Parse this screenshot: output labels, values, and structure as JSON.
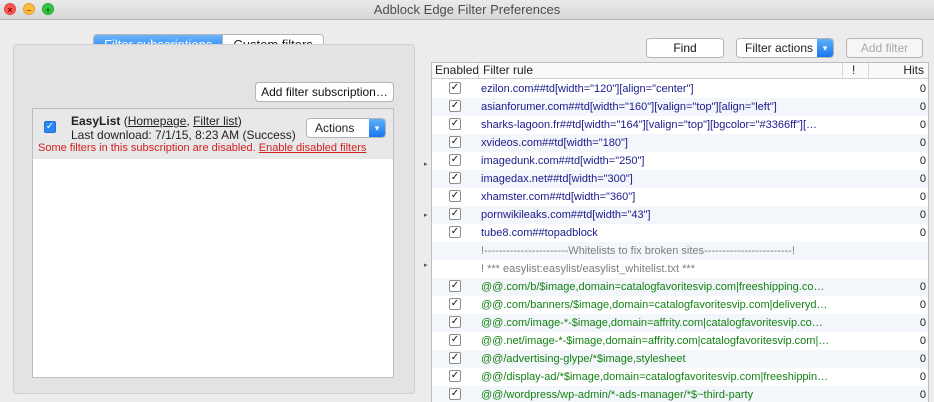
{
  "window": {
    "title": "Adblock Edge Filter Preferences"
  },
  "tabs": [
    {
      "label": "Filter subscriptions",
      "active": true
    },
    {
      "label": "Custom filters",
      "active": false
    }
  ],
  "left": {
    "add_subscription_label": "Add filter subscription…",
    "subscription": {
      "name": "EasyList",
      "homepage_label": "Homepage",
      "filterlist_label": "Filter list",
      "last_download": "Last download:  7/1/15, 8:23 AM (Success)",
      "warning": "Some filters in this subscription are disabled.",
      "enable_link": "Enable disabled filters",
      "actions_label": "Actions",
      "enabled": true
    }
  },
  "toolbar": {
    "find_label": "Find",
    "filter_actions_label": "Filter actions",
    "add_filter_label": "Add filter"
  },
  "table": {
    "headers": {
      "enabled": "Enabled",
      "rule": "Filter rule",
      "flag": "!",
      "hits": "Hits"
    },
    "rows": [
      {
        "enabled": true,
        "rule": "ezilon.com##td[width=\"120\"][align=\"center\"]",
        "hits": "0",
        "kind": "rule"
      },
      {
        "enabled": true,
        "rule": "asianforumer.com##td[width=\"160\"][valign=\"top\"][align=\"left\"]",
        "hits": "0",
        "kind": "rule"
      },
      {
        "enabled": true,
        "rule": "sharks-lagoon.fr##td[width=\"164\"][valign=\"top\"][bgcolor=\"#3366ff\"][…",
        "hits": "0",
        "kind": "rule"
      },
      {
        "enabled": true,
        "rule": "xvideos.com##td[width=\"180\"]",
        "hits": "0",
        "kind": "rule"
      },
      {
        "enabled": true,
        "rule": "imagedunk.com##td[width=\"250\"]",
        "hits": "0",
        "kind": "rule"
      },
      {
        "enabled": true,
        "rule": "imagedax.net##td[width=\"300\"]",
        "hits": "0",
        "kind": "rule"
      },
      {
        "enabled": true,
        "rule": "xhamster.com##td[width=\"360\"]",
        "hits": "0",
        "kind": "rule"
      },
      {
        "enabled": true,
        "rule": "pornwikileaks.com##td[width=\"43\"]",
        "hits": "0",
        "kind": "rule"
      },
      {
        "enabled": true,
        "rule": "tube8.com##topadblock",
        "hits": "0",
        "kind": "rule"
      },
      {
        "enabled": null,
        "rule": "!-----------------------Whitelists to fix broken sites------------------------!",
        "hits": "",
        "kind": "comment"
      },
      {
        "enabled": null,
        "rule": "! *** easylist:easylist/easylist_whitelist.txt ***",
        "hits": "",
        "kind": "comment"
      },
      {
        "enabled": true,
        "rule": "@@.com/b/$image,domain=catalogfavoritesvip.com|freeshipping.co…",
        "hits": "0",
        "kind": "exception"
      },
      {
        "enabled": true,
        "rule": "@@.com/banners/$image,domain=catalogfavoritesvip.com|deliveryd…",
        "hits": "0",
        "kind": "exception"
      },
      {
        "enabled": true,
        "rule": "@@.com/image-*-$image,domain=affrity.com|catalogfavoritesvip.co…",
        "hits": "0",
        "kind": "exception"
      },
      {
        "enabled": true,
        "rule": "@@.net/image-*-$image,domain=affrity.com|catalogfavoritesvip.com|…",
        "hits": "0",
        "kind": "exception"
      },
      {
        "enabled": true,
        "rule": "@@/advertising-glype/*$image,stylesheet",
        "hits": "0",
        "kind": "exception"
      },
      {
        "enabled": true,
        "rule": "@@/display-ad/*$image,domain=catalogfavoritesvip.com|freeshippin…",
        "hits": "0",
        "kind": "exception"
      },
      {
        "enabled": true,
        "rule": "@@/wordpress/wp-admin/*-ads-manager/*$~third-party",
        "hits": "0",
        "kind": "exception"
      }
    ]
  },
  "colors": {
    "rule": "#1a1a8c",
    "exception": "#148214",
    "comment": "#7d7d7d",
    "warning": "#d21f1f",
    "accent": "#1677f0"
  }
}
